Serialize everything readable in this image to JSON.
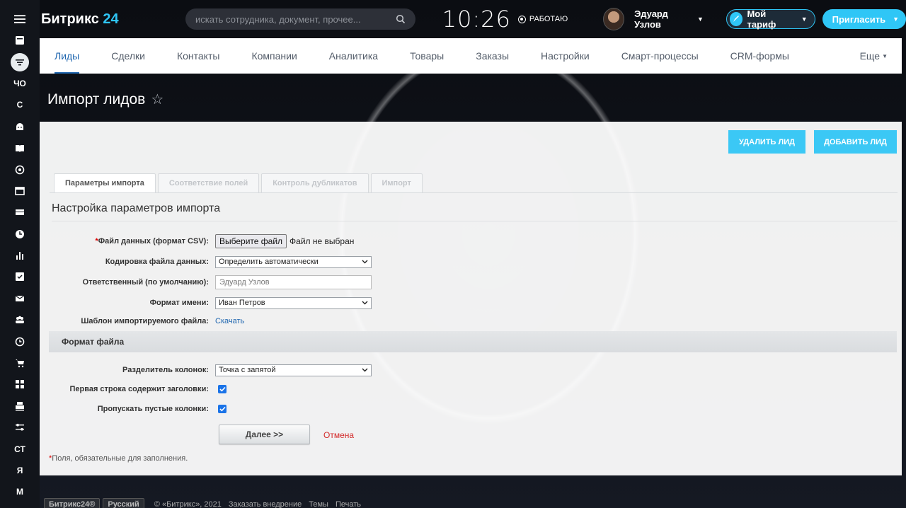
{
  "sidebar": {
    "items": [
      {
        "icon": "menu-icon",
        "text": ""
      },
      {
        "icon": "feed-icon",
        "text": ""
      },
      {
        "icon": "crm-funnel-icon",
        "text": ""
      },
      {
        "icon": "",
        "text": "ЧО"
      },
      {
        "icon": "",
        "text": "С"
      },
      {
        "icon": "android-icon",
        "text": ""
      },
      {
        "icon": "book-icon",
        "text": ""
      },
      {
        "icon": "target-icon",
        "text": ""
      },
      {
        "icon": "window-icon",
        "text": ""
      },
      {
        "icon": "inbox-icon",
        "text": ""
      },
      {
        "icon": "clock-circle-icon",
        "text": ""
      },
      {
        "icon": "bar-chart-icon",
        "text": ""
      },
      {
        "icon": "checkbox-icon",
        "text": ""
      },
      {
        "icon": "mail-icon",
        "text": ""
      },
      {
        "icon": "group-icon",
        "text": ""
      },
      {
        "icon": "clock-icon",
        "text": ""
      },
      {
        "icon": "cart-icon",
        "text": ""
      },
      {
        "icon": "grid-icon",
        "text": ""
      },
      {
        "icon": "printer-icon",
        "text": ""
      },
      {
        "icon": "sliders-icon",
        "text": ""
      },
      {
        "icon": "",
        "text": "СТ"
      },
      {
        "icon": "",
        "text": "Я"
      },
      {
        "icon": "",
        "text": "М"
      }
    ]
  },
  "header": {
    "logo_text": "Битрикс",
    "logo_num": "24",
    "search_placeholder": "искать сотрудника, документ, прочее...",
    "clock": "10:26",
    "work_status": "РАБОТАЮ",
    "user_name": "Эдуард Узлов",
    "tariff_label": "Мой тариф",
    "invite_label": "Пригласить"
  },
  "crm_nav": {
    "tabs": [
      "Лиды",
      "Сделки",
      "Контакты",
      "Компании",
      "Аналитика",
      "Товары",
      "Заказы",
      "Настройки",
      "Смарт-процессы",
      "CRM-формы"
    ],
    "more": "Еще"
  },
  "page": {
    "title": "Импорт лидов",
    "delete_lead": "УДАЛИТЬ ЛИД",
    "add_lead": "ДОБАВИТЬ ЛИД",
    "tabs": [
      "Параметры импорта",
      "Соответствие полей",
      "Контроль дубликатов",
      "Импорт"
    ],
    "section_title": "Настройка параметров импорта",
    "fields": {
      "file_label": "Файл данных (формат CSV):",
      "file_button": "Выберите файл",
      "file_status": "Файл не выбран",
      "encoding_label": "Кодировка файла данных:",
      "encoding_value": "Определить автоматически",
      "responsible_label": "Ответственный (по умолчанию):",
      "responsible_value": "Эдуард Узлов",
      "name_format_label": "Формат имени:",
      "name_format_value": "Иван Петров",
      "template_label": "Шаблон импортируемого файла:",
      "template_link": "Скачать"
    },
    "file_format_band": "Формат файла",
    "format": {
      "separator_label": "Разделитель колонок:",
      "separator_value": "Точка с запятой",
      "first_row_label": "Первая строка содержит заголовки:",
      "first_row_checked": true,
      "skip_empty_label": "Пропускать пустые колонки:",
      "skip_empty_checked": true
    },
    "next_button": "Далее >>",
    "cancel": "Отмена",
    "required_note": "Поля, обязательные для заполнения."
  },
  "footer": {
    "logo": "Битрикс24®",
    "lang": "Русский",
    "copyright": "© «Битрикс», 2021",
    "order": "Заказать внедрение",
    "themes": "Темы",
    "print": "Печать"
  },
  "colors": {
    "accent": "#2fc6f6",
    "link": "#2067b0",
    "button": "#3bc8f5",
    "cancel": "#d32a2a"
  }
}
